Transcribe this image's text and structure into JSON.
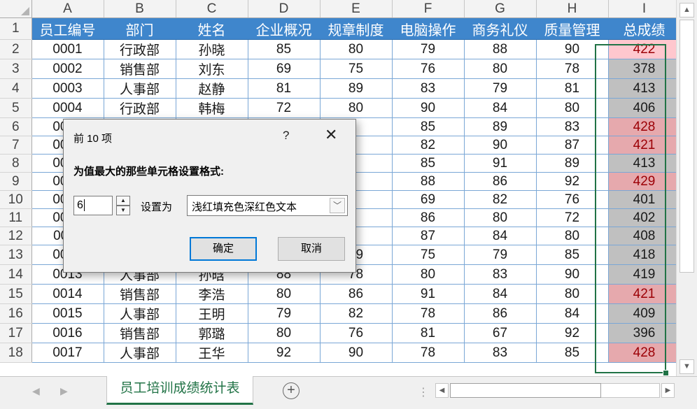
{
  "columns": [
    "A",
    "B",
    "C",
    "D",
    "E",
    "F",
    "G",
    "H",
    "I"
  ],
  "headers": [
    "员工编号",
    "部门",
    "姓名",
    "企业概况",
    "规章制度",
    "电脑操作",
    "商务礼仪",
    "质量管理",
    "总成绩"
  ],
  "rows": [
    {
      "num": "2",
      "cells": [
        "0001",
        "行政部",
        "孙晓",
        "85",
        "80",
        "79",
        "88",
        "90",
        "422"
      ],
      "hi": "first"
    },
    {
      "num": "3",
      "cells": [
        "0002",
        "销售部",
        "刘东",
        "69",
        "75",
        "76",
        "80",
        "78",
        "378"
      ],
      "hi": ""
    },
    {
      "num": "4",
      "cells": [
        "0003",
        "人事部",
        "赵静",
        "81",
        "89",
        "83",
        "79",
        "81",
        "413"
      ],
      "hi": ""
    },
    {
      "num": "5",
      "cells": [
        "0004",
        "行政部",
        "韩梅",
        "72",
        "80",
        "90",
        "84",
        "80",
        "406"
      ],
      "hi": ""
    },
    {
      "num": "6",
      "cells": [
        "0005",
        "",
        "",
        "",
        "",
        "85",
        "89",
        "83",
        "428"
      ],
      "hi": "hi"
    },
    {
      "num": "7",
      "cells": [
        "0006",
        "",
        "",
        "",
        "",
        "82",
        "90",
        "87",
        "421"
      ],
      "hi": "hi"
    },
    {
      "num": "8",
      "cells": [
        "0007",
        "",
        "",
        "",
        "",
        "85",
        "91",
        "89",
        "413"
      ],
      "hi": ""
    },
    {
      "num": "9",
      "cells": [
        "0008",
        "",
        "",
        "",
        "",
        "88",
        "86",
        "92",
        "429"
      ],
      "hi": "hi"
    },
    {
      "num": "10",
      "cells": [
        "0009",
        "",
        "",
        "",
        "",
        "69",
        "82",
        "76",
        "401"
      ],
      "hi": ""
    },
    {
      "num": "11",
      "cells": [
        "0010",
        "",
        "",
        "",
        "",
        "86",
        "80",
        "72",
        "402"
      ],
      "hi": ""
    },
    {
      "num": "12",
      "cells": [
        "0011",
        "",
        "",
        "",
        "",
        "87",
        "84",
        "80",
        "408"
      ],
      "hi": ""
    },
    {
      "num": "13",
      "cells": [
        "0012",
        "财务部",
        "",
        "90",
        "89",
        "75",
        "79",
        "85",
        "418"
      ],
      "hi": ""
    },
    {
      "num": "14",
      "cells": [
        "0013",
        "人事部",
        "孙晗",
        "88",
        "78",
        "80",
        "83",
        "90",
        "419"
      ],
      "hi": ""
    },
    {
      "num": "15",
      "cells": [
        "0014",
        "销售部",
        "李浩",
        "80",
        "86",
        "91",
        "84",
        "80",
        "421"
      ],
      "hi": "hi"
    },
    {
      "num": "16",
      "cells": [
        "0015",
        "人事部",
        "王明",
        "79",
        "82",
        "78",
        "86",
        "84",
        "409"
      ],
      "hi": ""
    },
    {
      "num": "17",
      "cells": [
        "0016",
        "销售部",
        "郭璐",
        "80",
        "76",
        "81",
        "67",
        "92",
        "396"
      ],
      "hi": ""
    },
    {
      "num": "18",
      "cells": [
        "0017",
        "人事部",
        "王华",
        "92",
        "90",
        "78",
        "83",
        "85",
        "428"
      ],
      "hi": "hi"
    }
  ],
  "sheet_tab": "员工培训成绩统计表",
  "dialog": {
    "title": "前 10 项",
    "help": "?",
    "close": "✕",
    "prompt": "为值最大的那些单元格设置格式:",
    "count_value": "6",
    "set_as_label": "设置为",
    "format_value": "浅红填充色深红色文本",
    "ok_label": "确定",
    "cancel_label": "取消"
  },
  "colors": {
    "header_fill": "#3f86cc",
    "highlight_fill": "#e6a9ad",
    "highlight_text": "#9c0006",
    "total_fill": "#c0c0c0",
    "sheet_tab_text": "#217346"
  },
  "icons": {
    "add_sheet": "plus-circle-icon",
    "dropdown": "chevron-down-icon"
  }
}
